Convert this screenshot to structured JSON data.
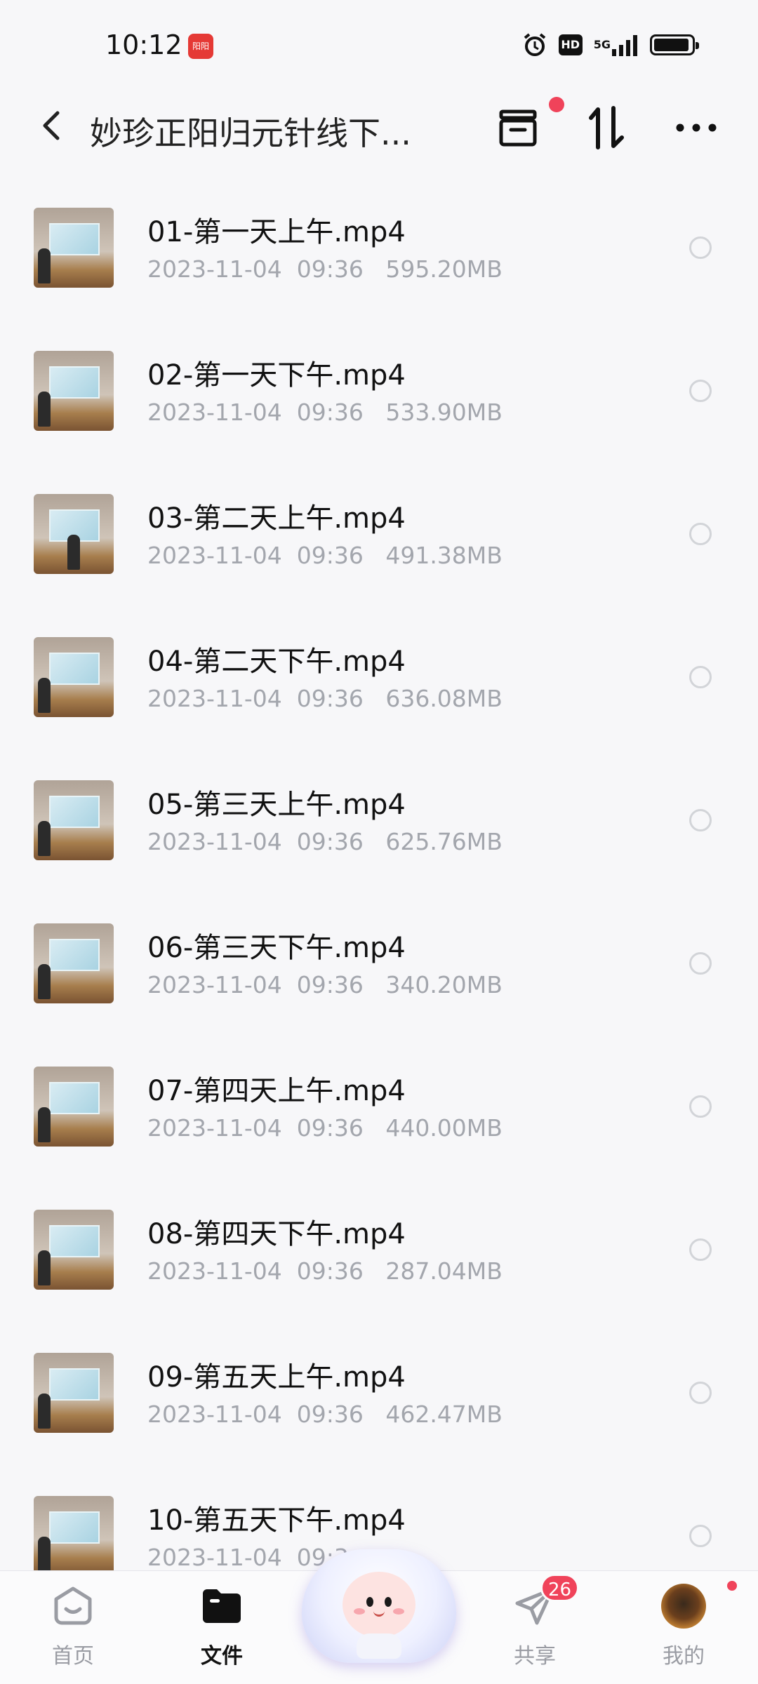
{
  "status_bar": {
    "time": "10:12",
    "app_badge": "阳阳",
    "hd": "HD",
    "network": "5G",
    "icons": [
      "alarm-icon",
      "hd-icon",
      "signal-5g-icon",
      "battery-icon"
    ],
    "battery_level": 0.95
  },
  "header": {
    "title": "妙珍正阳归元针线下...",
    "icons": [
      "back-icon",
      "archive-icon",
      "sort-icon",
      "more-icon"
    ]
  },
  "files": [
    {
      "name": "01-第一天上午.mp4",
      "meta": "2023-11-04  09:36   595.20MB"
    },
    {
      "name": "02-第一天下午.mp4",
      "meta": "2023-11-04  09:36   533.90MB"
    },
    {
      "name": "03-第二天上午.mp4",
      "meta": "2023-11-04  09:36   491.38MB"
    },
    {
      "name": "04-第二天下午.mp4",
      "meta": "2023-11-04  09:36   636.08MB"
    },
    {
      "name": "05-第三天上午.mp4",
      "meta": "2023-11-04  09:36   625.76MB"
    },
    {
      "name": "06-第三天下午.mp4",
      "meta": "2023-11-04  09:36   340.20MB"
    },
    {
      "name": "07-第四天上午.mp4",
      "meta": "2023-11-04  09:36   440.00MB"
    },
    {
      "name": "08-第四天下午.mp4",
      "meta": "2023-11-04  09:36   287.04MB"
    },
    {
      "name": "09-第五天上午.mp4",
      "meta": "2023-11-04  09:36   462.47MB"
    },
    {
      "name": "10-第五天下午.mp4",
      "meta": "2023-11-04  09:3"
    }
  ],
  "bottom_nav": {
    "home": "首页",
    "files": "文件",
    "share": "共享",
    "mine": "我的",
    "share_badge": "26",
    "active": "files"
  },
  "colors": {
    "accent_red": "#f0435a",
    "meta_gray": "#a3a6ad",
    "background": "#f7f7f9"
  }
}
